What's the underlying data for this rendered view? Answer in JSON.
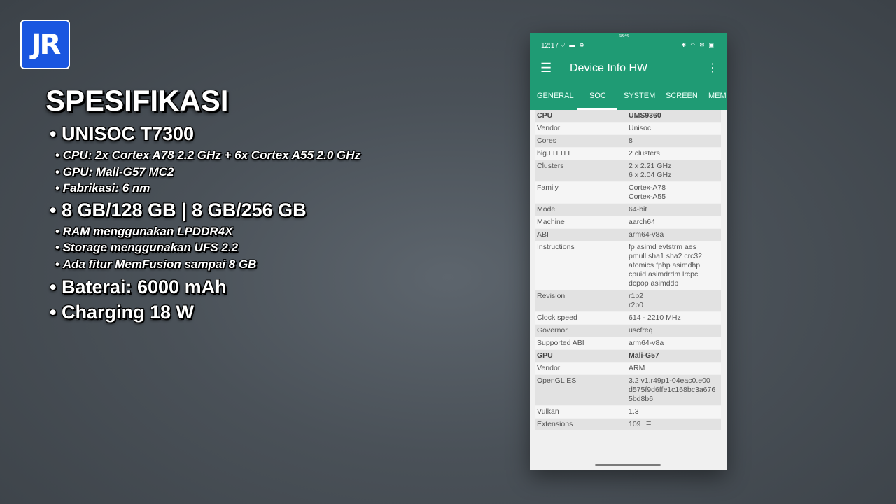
{
  "logo": {
    "text": "JR"
  },
  "specs": {
    "title": "SPESIFIKASI",
    "chip": "UNISOC T7300",
    "cpu": "CPU: 2x Cortex A78 2.2 GHz + 6x Cortex A55 2.0 GHz",
    "gpu": "GPU: Mali-G57 MC2",
    "fab": "Fabrikasi: 6 nm",
    "memory": "8 GB/128 GB |  8 GB/256 GB",
    "ram": "RAM menggunakan LPDDR4X",
    "storage": "Storage menggunakan UFS 2.2",
    "memfusion": "Ada fitur MemFusion sampai 8 GB",
    "battery": "Baterai: 6000 mAh",
    "charging": "Charging 18 W"
  },
  "phone": {
    "status": {
      "time": "12:17",
      "battery_badge": "56%",
      "left_icons": "⛉ ▬ ♻",
      "right_icons": "✱ ◠ ✉ ▣"
    },
    "appbar": {
      "title": "Device Info HW",
      "menu_icon": "hamburger-icon",
      "more_icon": "more-vert-icon"
    },
    "tabs": [
      "GENERAL",
      "SOC",
      "SYSTEM",
      "SCREEN",
      "MEM"
    ],
    "active_tab": "SOC",
    "rows": [
      {
        "k": "CPU",
        "v": "UMS9360",
        "header": true
      },
      {
        "k": "Vendor",
        "v": "Unisoc"
      },
      {
        "k": "Cores",
        "v": "8"
      },
      {
        "k": "big.LITTLE",
        "v": "2 clusters"
      },
      {
        "k": "Clusters",
        "v": "2 x 2.21 GHz\n6 x 2.04 GHz"
      },
      {
        "k": "Family",
        "v": "Cortex-A78\nCortex-A55"
      },
      {
        "k": "Mode",
        "v": "64-bit"
      },
      {
        "k": "Machine",
        "v": "aarch64"
      },
      {
        "k": "ABI",
        "v": "arm64-v8a"
      },
      {
        "k": "Instructions",
        "v": "fp asimd evtstrm aes\npmull sha1 sha2 crc32\natomics fphp asimdhp\ncpuid asimdrdm lrcpc\ndcpop asimddp"
      },
      {
        "k": "Revision",
        "v": "r1p2\nr2p0"
      },
      {
        "k": "Clock speed",
        "v": "614 - 2210 MHz"
      },
      {
        "k": "Governor",
        "v": "uscfreq"
      },
      {
        "k": "Supported ABI",
        "v": "arm64-v8a"
      },
      {
        "k": "GPU",
        "v": "Mali-G57",
        "header": true
      },
      {
        "k": "Vendor",
        "v": "ARM"
      },
      {
        "k": "OpenGL ES",
        "v": "3.2 v1.r49p1-04eac0.e00\nd575f9d6ffe1c168bc3a676\n5bd8b6"
      },
      {
        "k": "Vulkan",
        "v": "1.3"
      },
      {
        "k": "Extensions",
        "v": "109",
        "icon": "list-icon"
      }
    ]
  }
}
